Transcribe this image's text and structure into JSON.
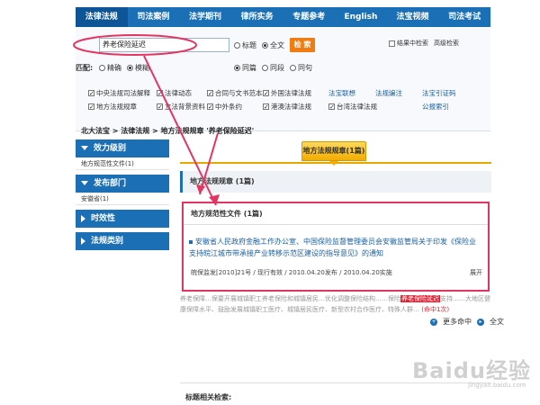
{
  "nav": {
    "items": [
      "法律法规",
      "司法案例",
      "法学期刊",
      "律所实务",
      "专题参考",
      "English",
      "法宝视频",
      "司法考试"
    ]
  },
  "search": {
    "query": "养老保险延迟",
    "scope_title": "标题",
    "scope_full": "全文",
    "button": "检 索",
    "in_results": "结果中检索",
    "advanced": "高级检索",
    "match_label": "匹配:",
    "match_exact": "精确",
    "match_fuzzy": "模糊",
    "para_same": "同篇",
    "para_same2": "同段",
    "para_same3": "同句"
  },
  "databases": {
    "items": [
      {
        "label": "中央法规司法解释",
        "checked": true
      },
      {
        "label": "法律动态",
        "checked": true
      },
      {
        "label": "合同与文书范本",
        "checked": true
      },
      {
        "label": "外国法律法规",
        "checked": true
      },
      {
        "label": "法宝联想",
        "checked": false
      },
      {
        "label": "法规编注",
        "checked": false
      },
      {
        "label": "法宝引证码",
        "checked": false
      },
      {
        "label": "地方法规规章",
        "checked": true
      },
      {
        "label": "立法背景资料",
        "checked": true
      },
      {
        "label": "中外条约",
        "checked": true
      },
      {
        "label": "港澳法律法规",
        "checked": true
      },
      {
        "label": "台湾法律法规",
        "checked": true
      },
      {
        "label": "",
        "checked": false
      },
      {
        "label": "公报索引",
        "checked": false
      }
    ]
  },
  "breadcrumb": "北大法宝 > 法律法规 > 地方法规规章 '养老保险延迟'",
  "sidebar": {
    "sections": [
      {
        "label": "效力级别",
        "open": true,
        "subs": [
          "地方规范性文件(1)"
        ]
      },
      {
        "label": "发布部门",
        "open": true,
        "subs": [
          "安徽省(1)"
        ]
      },
      {
        "label": "时效性",
        "open": false,
        "subs": []
      },
      {
        "label": "法规类别",
        "open": false,
        "subs": []
      }
    ]
  },
  "main": {
    "tab_label": "地方法规规章(1篇)",
    "section_title": "地方法规规章 (1篇)",
    "result_group": "地方规范性文件 (1篇)",
    "result_title": "安徽省人民政府金融工作办公室、中国保险监督管理委员会安徽监管局关于印发《保险业支持皖江城市带承接产业转移示范区建设的指导意见》的通知",
    "result_meta": "皖保监发[2010]21号 / 现行有效 / 2010.04.20发布 / 2010.04.20实施",
    "result_expand": "展开",
    "snippet_pre": "养老保障…保要开展城镇职工养老保险和城镇居民…优化调整保险结构……保险",
    "snippet_hl": "养老保险延迟",
    "snippet_post": "支持……大地区健康保障水平、鼓励发展城镇职工医疗、城镇居民医疗、新型农村合作医疗、特殊人群…",
    "hit_count": "(命中1次)",
    "more": "更多命中",
    "full": "全文",
    "bottom_label": "标题相关检索:"
  },
  "watermark": {
    "text": "Baidu经验",
    "sub": "jingyan.baidu.com"
  },
  "colors": {
    "nav_blue": "#1a6fb5",
    "highlight_border": "#e23562",
    "tab_gold": "#f2ad00",
    "search_btn": "#f07d12"
  }
}
